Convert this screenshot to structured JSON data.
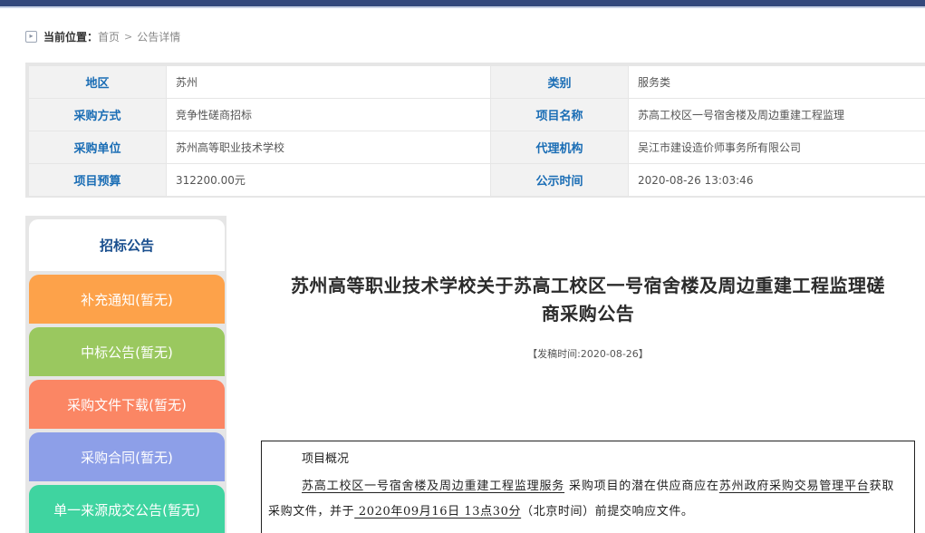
{
  "colors": {
    "top_bar": "#34497c",
    "label_text": "#1a6db5",
    "tab_orange": "#fda24a",
    "tab_green": "#9ac85f",
    "tab_salmon": "#fb8664",
    "tab_blue": "#8d9fe8",
    "tab_teal": "#3fd4a0"
  },
  "breadcrumb": {
    "icon": "home-icon",
    "lead": "当前位置：",
    "home": "首页",
    "separator": ">",
    "current": "公告详情"
  },
  "info": {
    "rows": [
      {
        "k1": "地区",
        "v1": "苏州",
        "k2": "类别",
        "v2": "服务类"
      },
      {
        "k1": "采购方式",
        "v1": "竞争性磋商招标",
        "k2": "项目名称",
        "v2": "苏高工校区一号宿舍楼及周边重建工程监理"
      },
      {
        "k1": "采购单位",
        "v1": "苏州高等职业技术学校",
        "k2": "代理机构",
        "v2": "吴江市建设造价师事务所有限公司"
      },
      {
        "k1": "项目预算",
        "v1": "312200.00元",
        "k2": "公示时间",
        "v2": "2020-08-26 13:03:46"
      }
    ]
  },
  "tabs": {
    "active": "招标公告",
    "items": [
      "补充通知(暂无)",
      "中标公告(暂无)",
      "采购文件下载(暂无)",
      "采购合同(暂无)",
      "单一来源成交公告(暂无)"
    ]
  },
  "article": {
    "title_line1": "苏州高等职业技术学校关于苏高工校区一号宿舍楼及周边重建工程监理磋",
    "title_line2": "商采购公告",
    "date": "【发稿时间:2020-08-26】"
  },
  "notice": {
    "heading": "项目概况",
    "project": "苏高工校区一号宿舍楼及周边重建工程监理服务",
    "text1": " 采购项目的潜在供应商应在",
    "platform": "苏州政府采购交易管理平台",
    "text2": "获取采购文件，并于",
    "deadline": " 2020年09月16日  13点30分",
    "text3": "（北京时间）前提交响应文件。"
  }
}
